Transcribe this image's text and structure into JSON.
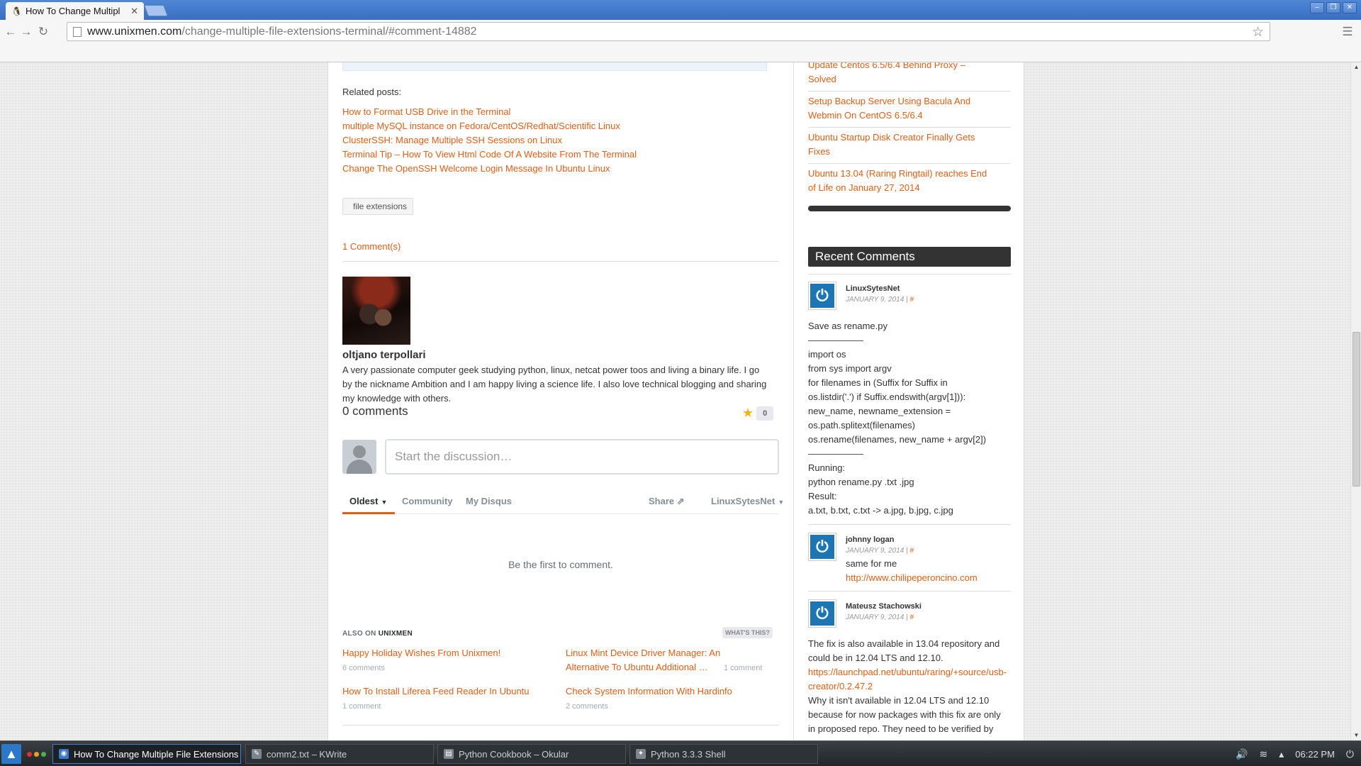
{
  "browser": {
    "tab_title": "How To Change Multipl",
    "url_domain": "www.unixmen.com",
    "url_path": "/change-multiple-file-extensions-terminal/#comment-14882"
  },
  "article": {
    "related_title": "Related posts:",
    "related_posts": [
      "How to Format USB Drive in the Terminal",
      "multiple MySQL instance on Fedora/CentOS/Redhat/Scientific Linux",
      "ClusterSSH: Manage Multiple SSH Sessions on Linux",
      "Terminal Tip – How To View Html Code Of A Website From The Terminal",
      "Change The OpenSSH Welcome Login Message In Ubuntu Linux"
    ],
    "tag": "file extensions",
    "comments_count": "1 Comment(s)",
    "author_name": "oltjano terpollari",
    "author_bio": "A very passionate computer geek studying python, linux, netcat power toos and living a binary life. I go by the nickname Ambition and I am happy living a science life. I also love technical blogging and sharing my knowledge with others."
  },
  "disqus": {
    "count_label": "0 comments",
    "recommend_count": "0",
    "input_placeholder": "Start the discussion…",
    "tabs": [
      "Oldest",
      "Community",
      "My Disqus"
    ],
    "share_label": "Share",
    "user_label": "LinuxSytesNet",
    "empty_text": "Be the first to comment.",
    "also_on_prefix": "ALSO ON",
    "also_on_brand": "UNIXMEN",
    "whats_this": "WHAT'S THIS?",
    "related": [
      {
        "title": "Happy Holiday Wishes From Unixmen!",
        "count": "6 comments"
      },
      {
        "title_line1": "Linux Mint Device Driver Manager: An",
        "title_line2": "Alternative To Ubuntu Additional …",
        "count": "1 comment"
      },
      {
        "title": "How To Install Liferea Feed Reader In Ubuntu",
        "count": "1 comment"
      },
      {
        "title": "Check System Information With Hardinfo",
        "count": "2 comments"
      }
    ]
  },
  "sidebar": {
    "posts": [
      {
        "line1": "Update Centos 6.5/6.4 Behind Proxy –",
        "line2": "Solved"
      },
      {
        "line1": "Setup Backup Server Using Bacula And",
        "line2": "Webmin On CentOS 6.5/6.4"
      },
      {
        "line1": "Ubuntu Startup Disk Creator Finally Gets",
        "line2": "Fixes"
      },
      {
        "line1": "Ubuntu 13.04 (Raring Ringtail) reaches End",
        "line2": "of Life on January 27, 2014"
      }
    ],
    "recent_comments_title": "Recent Comments",
    "comments": [
      {
        "author": "LinuxSytesNet",
        "date": "JANUARY 9, 2014 | ",
        "hash": "#",
        "lines": [
          "Save as rename.py",
          "",
          "import os",
          "from sys import argv",
          "for filenames in (Suffix for Suffix in",
          "os.listdir('.') if Suffix.endswith(argv[1])):",
          "new_name, newname_extension =",
          "os.path.splitext(filenames)",
          "os.rename(filenames, new_name + argv[2])",
          "",
          "Running:",
          "python rename.py .txt .jpg",
          "Result:",
          "a.txt, b.txt, c.txt -> a.jpg, b.jpg, c.jpg"
        ]
      },
      {
        "author": "johnny logan",
        "date": "JANUARY 9, 2014 | ",
        "hash": "#",
        "text": "same for me",
        "link": "http://www.chilipeperoncino.com"
      },
      {
        "author": "Mateusz Stachowski",
        "date": "JANUARY 9, 2014 | ",
        "hash": "#",
        "lines": [
          "The fix is also available in 13.04 repository and",
          "could be in 12.04 LTS and 12.10.",
          "https://launchpad.net/ubuntu/raring/+source/usb-",
          "creator/0.2.47.2",
          "Why it isn't available in 12.04 LTS and 12.10",
          "because for now packages with this fix are only",
          "in proposed repo. They need to be verified by"
        ]
      }
    ]
  },
  "taskbar": {
    "tasks": [
      "How To Change Multiple File Extensions",
      "comm2.txt – KWrite",
      "Python Cookbook – Okular",
      "Python 3.3.3 Shell"
    ],
    "clock": "06:22 PM"
  }
}
